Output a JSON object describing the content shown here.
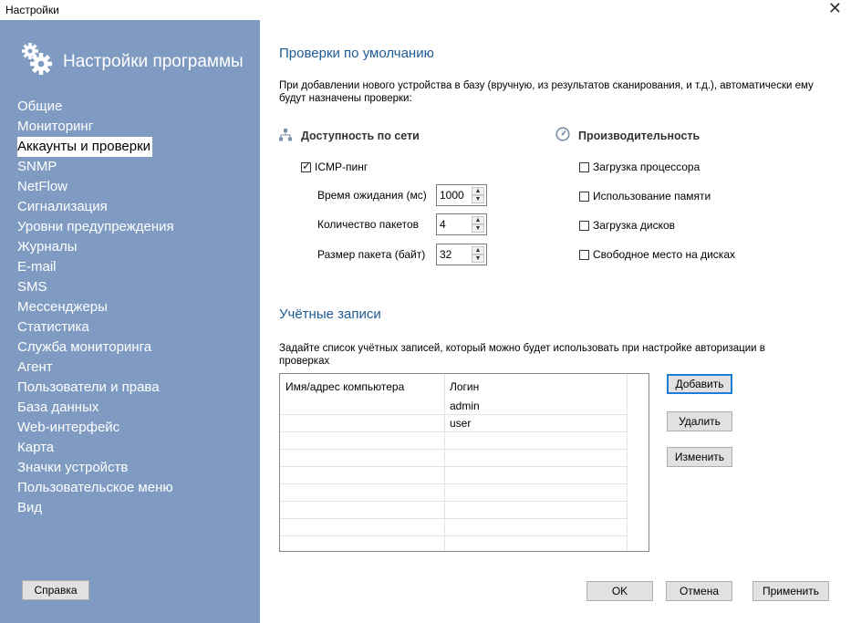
{
  "window": {
    "title": "Настройки"
  },
  "sidebar": {
    "header": "Настройки программы",
    "items": [
      {
        "label": "Общие",
        "active": false
      },
      {
        "label": "Мониторинг",
        "active": false
      },
      {
        "label": "Аккаунты и проверки",
        "active": true
      },
      {
        "label": "SNMP",
        "active": false
      },
      {
        "label": "NetFlow",
        "active": false
      },
      {
        "label": "Сигнализация",
        "active": false
      },
      {
        "label": "Уровни предупреждения",
        "active": false
      },
      {
        "label": "Журналы",
        "active": false
      },
      {
        "label": "E-mail",
        "active": false
      },
      {
        "label": "SMS",
        "active": false
      },
      {
        "label": "Мессенджеры",
        "active": false
      },
      {
        "label": "Статистика",
        "active": false
      },
      {
        "label": "Служба мониторинга",
        "active": false
      },
      {
        "label": "Агент",
        "active": false
      },
      {
        "label": "Пользователи и права",
        "active": false
      },
      {
        "label": "База данных",
        "active": false
      },
      {
        "label": "Web-интерфейс",
        "active": false
      },
      {
        "label": "Карта",
        "active": false
      },
      {
        "label": "Значки устройств",
        "active": false
      },
      {
        "label": "Пользовательское меню",
        "active": false
      },
      {
        "label": "Вид",
        "active": false
      }
    ],
    "help_button": "Справка"
  },
  "checks": {
    "title": "Проверки по умолчанию",
    "description": "При добавлении нового устройства в базу (вручную, из результатов сканирования, и т.д.), автоматически ему будут назначены проверки:",
    "network": {
      "title": "Доступность по сети",
      "icmp_label": "ICMP-пинг",
      "icmp_checked": true,
      "timeout_label": "Время ожидания (мс)",
      "timeout_value": "1000",
      "packets_label": "Количество пакетов",
      "packets_value": "4",
      "size_label": "Размер пакета (байт)",
      "size_value": "32"
    },
    "performance": {
      "title": "Производительность",
      "items": [
        {
          "label": "Загрузка процессора",
          "checked": false
        },
        {
          "label": "Использование памяти",
          "checked": false
        },
        {
          "label": "Загрузка дисков",
          "checked": false
        },
        {
          "label": "Свободное место на дисках",
          "checked": false
        }
      ]
    }
  },
  "accounts": {
    "title": "Учётные записи",
    "description": "Задайте список учётных записей, который можно будет использовать при настройке авторизации в проверках",
    "columns": [
      "Имя/адрес компьютера",
      "Логин"
    ],
    "rows": [
      {
        "host": "",
        "login": "admin"
      },
      {
        "host": "",
        "login": "user"
      },
      {
        "host": "",
        "login": ""
      },
      {
        "host": "",
        "login": ""
      },
      {
        "host": "",
        "login": ""
      },
      {
        "host": "",
        "login": ""
      },
      {
        "host": "",
        "login": ""
      },
      {
        "host": "",
        "login": ""
      }
    ],
    "add_button": "Добавить",
    "delete_button": "Удалить",
    "edit_button": "Изменить"
  },
  "footer": {
    "ok": "OK",
    "cancel": "Отмена",
    "apply": "Применить"
  },
  "colors": {
    "sidebar_bg": "#7f9bc2",
    "heading": "#1e5a96",
    "default_button_border": "#1c7fd6"
  }
}
